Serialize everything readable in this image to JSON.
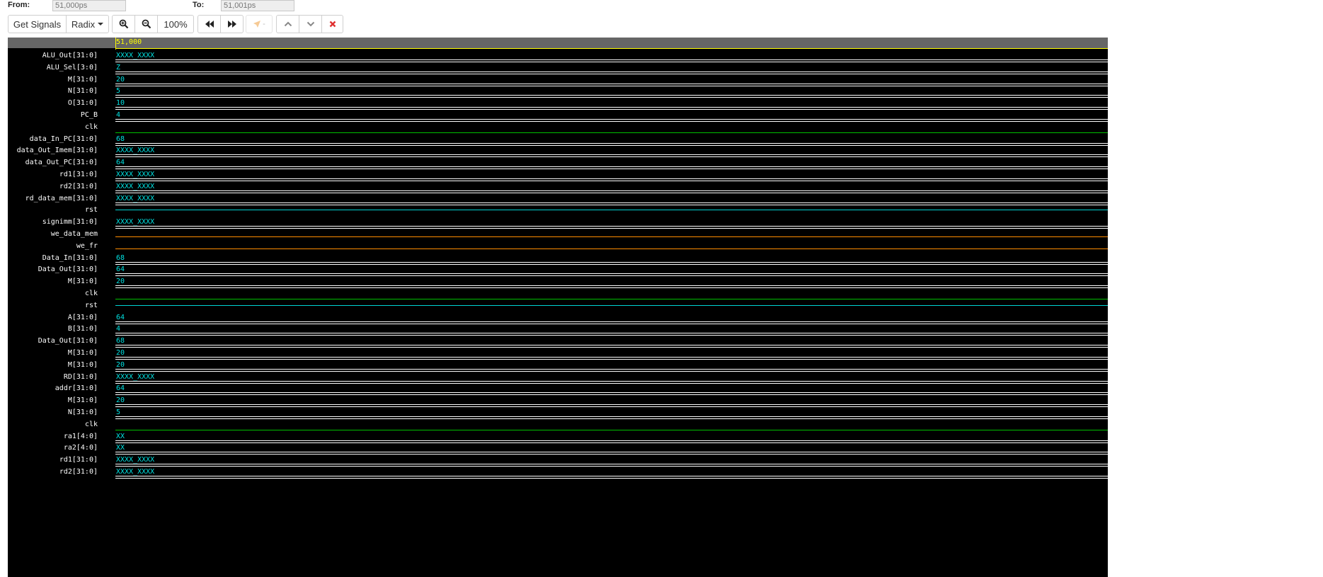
{
  "range": {
    "from_label": "From:",
    "from_value": "51,000ps",
    "to_label": "To:",
    "to_value": "51,001ps"
  },
  "toolbar": {
    "get_signals": "Get Signals",
    "radix": "Radix",
    "zoom_level": "100%",
    "marker_suffix": "-"
  },
  "icons": [
    "zoom-in-icon",
    "zoom-out-icon",
    "fast-backward-icon",
    "fast-forward-icon",
    "marker-icon",
    "chevron-up-icon",
    "chevron-down-icon",
    "close-icon"
  ],
  "colors": {
    "background": "#000000",
    "header": "#666666",
    "cursor": "#ffff00",
    "value_text": "#00e0e0",
    "signal_name_text": "#ffffff",
    "bus_line": "#ffffff",
    "bit_high": "#00d4d4",
    "bit_low": "#00c000",
    "bit_x": "#ff8c00",
    "clear_icon": "#e03030",
    "marker_icon": "#f0a040"
  },
  "wave": {
    "cursor_time": "51,000"
  },
  "signals": [
    {
      "name": "ALU_Out[31:0]",
      "value": "XXXX_XXXX",
      "kind": "bus"
    },
    {
      "name": "ALU_Sel[3:0]",
      "value": "Z",
      "kind": "bus"
    },
    {
      "name": "M[31:0]",
      "value": "20",
      "kind": "bus"
    },
    {
      "name": "N[31:0]",
      "value": "5",
      "kind": "bus"
    },
    {
      "name": "O[31:0]",
      "value": "10",
      "kind": "bus"
    },
    {
      "name": "PC_B",
      "value": "4",
      "kind": "bus"
    },
    {
      "name": "clk",
      "value": "",
      "kind": "low"
    },
    {
      "name": "data_In_PC[31:0]",
      "value": "68",
      "kind": "bus"
    },
    {
      "name": "data_Out_Imem[31:0]",
      "value": "XXXX_XXXX",
      "kind": "bus"
    },
    {
      "name": "data_Out_PC[31:0]",
      "value": "64",
      "kind": "bus"
    },
    {
      "name": "rd1[31:0]",
      "value": "XXXX_XXXX",
      "kind": "bus"
    },
    {
      "name": "rd2[31:0]",
      "value": "XXXX_XXXX",
      "kind": "bus"
    },
    {
      "name": "rd_data_mem[31:0]",
      "value": "XXXX_XXXX",
      "kind": "bus"
    },
    {
      "name": "rst",
      "value": "",
      "kind": "high"
    },
    {
      "name": "signimm[31:0]",
      "value": "XXXX_XXXX",
      "kind": "bus"
    },
    {
      "name": "we_data_mem",
      "value": "",
      "kind": "x"
    },
    {
      "name": "we_fr",
      "value": "",
      "kind": "x"
    },
    {
      "name": "Data_In[31:0]",
      "value": "68",
      "kind": "bus"
    },
    {
      "name": "Data_Out[31:0]",
      "value": "64",
      "kind": "bus"
    },
    {
      "name": "M[31:0]",
      "value": "20",
      "kind": "bus"
    },
    {
      "name": "clk",
      "value": "",
      "kind": "low"
    },
    {
      "name": "rst",
      "value": "",
      "kind": "high"
    },
    {
      "name": "A[31:0]",
      "value": "64",
      "kind": "bus"
    },
    {
      "name": "B[31:0]",
      "value": "4",
      "kind": "bus"
    },
    {
      "name": "Data_Out[31:0]",
      "value": "68",
      "kind": "bus"
    },
    {
      "name": "M[31:0]",
      "value": "20",
      "kind": "bus"
    },
    {
      "name": "M[31:0]",
      "value": "20",
      "kind": "bus"
    },
    {
      "name": "RD[31:0]",
      "value": "XXXX_XXXX",
      "kind": "bus"
    },
    {
      "name": "addr[31:0]",
      "value": "64",
      "kind": "bus"
    },
    {
      "name": "M[31:0]",
      "value": "20",
      "kind": "bus"
    },
    {
      "name": "N[31:0]",
      "value": "5",
      "kind": "bus"
    },
    {
      "name": "clk",
      "value": "",
      "kind": "low"
    },
    {
      "name": "ra1[4:0]",
      "value": "XX",
      "kind": "bus"
    },
    {
      "name": "ra2[4:0]",
      "value": "XX",
      "kind": "bus"
    },
    {
      "name": "rd1[31:0]",
      "value": "XXXX_XXXX",
      "kind": "bus"
    },
    {
      "name": "rd2[31:0]",
      "value": "XXXX_XXXX",
      "kind": "bus"
    }
  ]
}
